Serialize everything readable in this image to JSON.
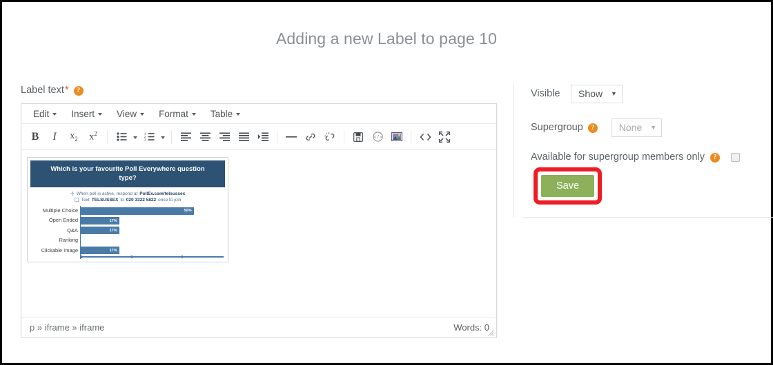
{
  "page": {
    "title": "Adding a new Label to page 10"
  },
  "editor": {
    "field_label": "Label text",
    "required_mark": "*",
    "help_icon": "help-icon",
    "menus": [
      {
        "label": "Edit"
      },
      {
        "label": "Insert"
      },
      {
        "label": "View"
      },
      {
        "label": "Format"
      },
      {
        "label": "Table"
      }
    ],
    "toolbar": [
      {
        "name": "bold-icon",
        "glyph": "B"
      },
      {
        "name": "italic-icon",
        "glyph": "I"
      },
      {
        "name": "subscript-icon",
        "glyph": "x₂"
      },
      {
        "name": "superscript-icon",
        "glyph": "x²"
      },
      {
        "name": "bullet-list-icon",
        "glyph": "☰"
      },
      {
        "name": "numbered-list-icon",
        "glyph": "☰"
      },
      {
        "name": "align-left-icon",
        "glyph": "≡"
      },
      {
        "name": "align-center-icon",
        "glyph": "≡"
      },
      {
        "name": "align-right-icon",
        "glyph": "≡"
      },
      {
        "name": "align-justify-icon",
        "glyph": "≡"
      },
      {
        "name": "outdent-icon",
        "glyph": "≡"
      },
      {
        "name": "horizontal-rule-icon",
        "glyph": "—"
      },
      {
        "name": "link-icon",
        "glyph": "🔗"
      },
      {
        "name": "unlink-icon",
        "glyph": "🔗"
      },
      {
        "name": "media-icon",
        "glyph": "▤"
      },
      {
        "name": "embed-code-icon",
        "glyph": "</>"
      },
      {
        "name": "image-icon",
        "glyph": "Ὓc"
      },
      {
        "name": "source-code-icon",
        "glyph": "<>"
      },
      {
        "name": "fullscreen-icon",
        "glyph": "⛶"
      }
    ],
    "statusbar": {
      "path": "p » iframe » iframe",
      "path_parts": [
        "p",
        "iframe",
        "iframe"
      ],
      "words": "Words: 0"
    }
  },
  "poll": {
    "title": "Which is your favourite Poll Everywhere question type?",
    "instruction_line1_prefix": "When poll is active, respond at ",
    "instruction_line1_bold": "PollEv.com/telsussex",
    "instruction_line2_prefix": "Text ",
    "instruction_line2_bold": "TELSUSSEX",
    "instruction_line2_mid": " to ",
    "instruction_line2_bold2": "020 3322 5822",
    "instruction_line2_suffix": " once to join",
    "header_color": "#2d5274",
    "bar_color": "#4a7ba7"
  },
  "chart_data": {
    "type": "bar",
    "orientation": "horizontal",
    "title": "Which is your favourite Poll Everywhere question type?",
    "categories": [
      "Multiple Choice",
      "Open Ended",
      "Q&A",
      "Ranking",
      "Clickable Image"
    ],
    "values": [
      50,
      17,
      17,
      0,
      17
    ],
    "labels": [
      "50%",
      "17%",
      "17%",
      "",
      "17%"
    ],
    "xlabel": "",
    "ylabel": "",
    "xlim": [
      0,
      55
    ],
    "grid": false,
    "legend": false
  },
  "settings": {
    "visible": {
      "label": "Visible",
      "value": "Show"
    },
    "supergroup": {
      "label": "Supergroup",
      "value": "None",
      "disabled": true,
      "help_icon": "help-icon"
    },
    "members_only": {
      "label": "Available for supergroup members only",
      "checked": false,
      "help_icon": "help-icon"
    },
    "save_label": "Save",
    "save_color": "#8cb15a",
    "annotation_color": "#ee1c24"
  }
}
